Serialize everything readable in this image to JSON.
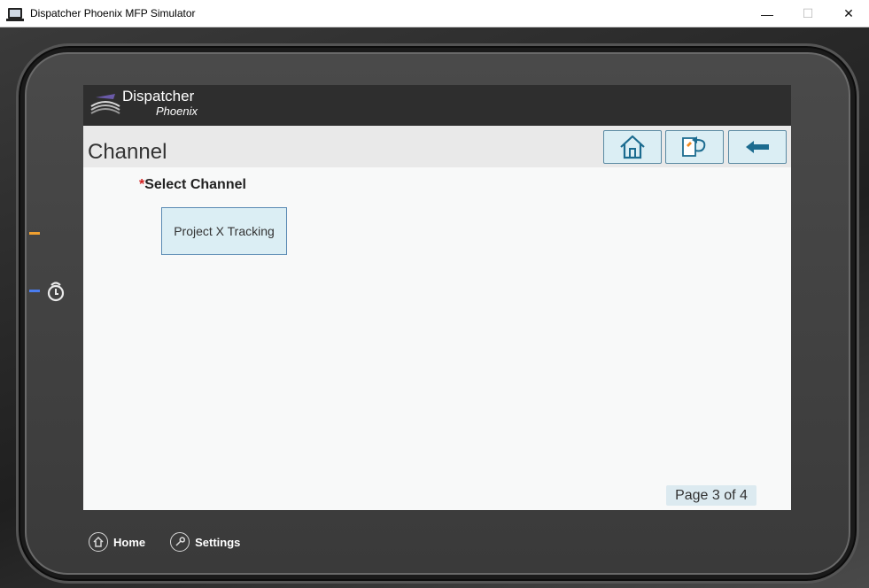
{
  "window": {
    "title": "Dispatcher Phoenix MFP Simulator",
    "minimize": "—",
    "maximize": "☐",
    "close": "✕"
  },
  "app": {
    "brand": "Dispatcher",
    "brand_sub": "Phoenix",
    "page_title": "Channel",
    "nav_icons": [
      "home-icon",
      "switch-icon",
      "back-arrow-icon"
    ]
  },
  "main": {
    "required_mark": "*",
    "section_label": "Select Channel",
    "channels": [
      "Project X Tracking"
    ],
    "page_indicator": "Page 3 of 4"
  },
  "device_bar": {
    "home_label": "Home",
    "settings_label": "Settings"
  },
  "colors": {
    "button_fill": "#dbeef4",
    "button_border": "#5a8aa3",
    "header_dark": "#2e2e2e",
    "accent_icon": "#1b6b8f",
    "required": "#d32020"
  }
}
